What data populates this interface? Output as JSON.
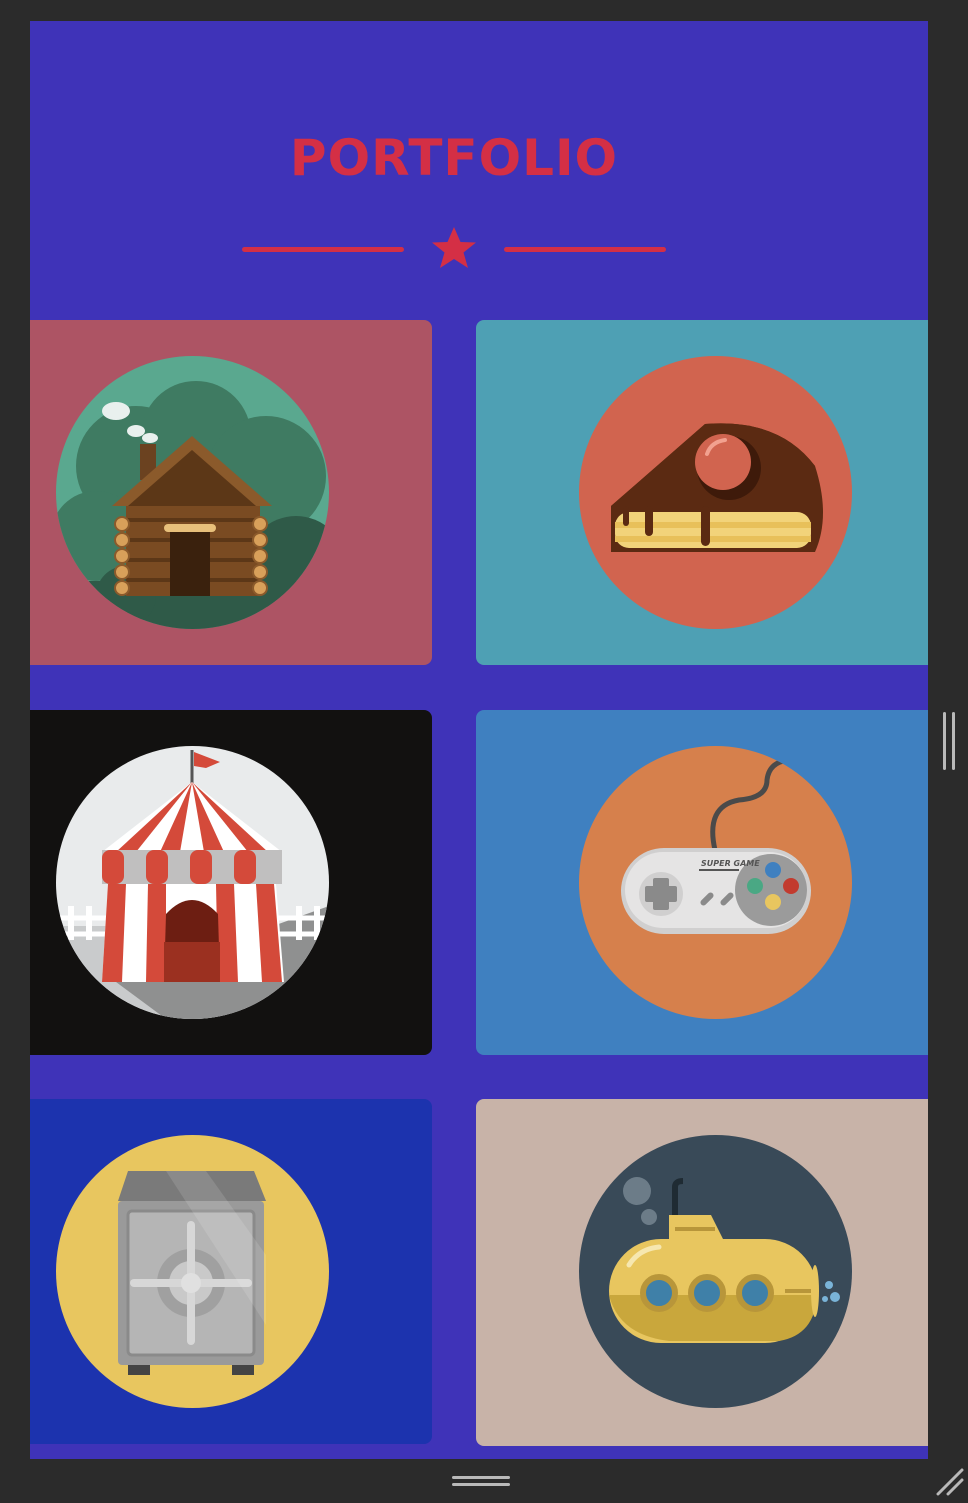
{
  "header": {
    "title": "PORTFOLIO",
    "accent_color": "#d42f45",
    "background_color": "#3f33b8"
  },
  "portfolio_items": [
    {
      "name": "log-cabin",
      "icon": "log-cabin-icon",
      "card_color": "#ad5464",
      "badge_color": "#3f8266"
    },
    {
      "name": "cake-slice",
      "icon": "cake-slice-icon",
      "card_color": "#4ea0b4",
      "badge_color": "#d1644f"
    },
    {
      "name": "circus-tent",
      "icon": "circus-tent-icon",
      "card_color": "#121110",
      "badge_color": "#e9ebec"
    },
    {
      "name": "game-controller",
      "icon": "game-controller-icon",
      "card_color": "#3f80c0",
      "badge_color": "#d6804c",
      "label": "SUPER GAME"
    },
    {
      "name": "safe",
      "icon": "safe-icon",
      "card_color": "#1c33ae",
      "badge_color": "#e8c65f"
    },
    {
      "name": "submarine",
      "icon": "submarine-icon",
      "card_color": "#c8b3a8",
      "badge_color": "#394a58"
    }
  ]
}
